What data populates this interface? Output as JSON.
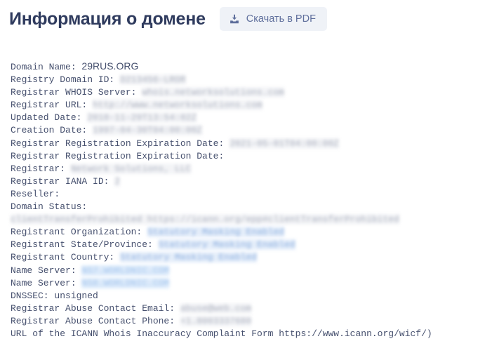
{
  "header": {
    "title": "Информация о домене",
    "pdf_button_label": "Скачать в PDF",
    "pdf_button_icon": "download-icon",
    "title_color": "#2f3b5e",
    "button_bg": "#eff2f7",
    "button_text_color": "#5f6f9c"
  },
  "whois": {
    "lines": [
      {
        "label": "Domain Name: ",
        "value": "29RUS.ORG",
        "style": "plain"
      },
      {
        "label": "Registry Domain ID: ",
        "value": "D213456-LROR",
        "style": "grey"
      },
      {
        "label": "Registrar WHOIS Server: ",
        "value": "whois.networksolutions.com",
        "style": "grey"
      },
      {
        "label": "Registrar URL: ",
        "value": "http://www.networksolutions.com",
        "style": "grey"
      },
      {
        "label": "Updated Date: ",
        "value": "2018-11-29T13:54:02Z",
        "style": "grey"
      },
      {
        "label": "Creation Date: ",
        "value": "1997-04-30T04:00:00Z",
        "style": "grey"
      },
      {
        "label": "Registrar Registration Expiration Date: ",
        "value": "2021-05-01T04:00:00Z",
        "style": "grey"
      },
      {
        "label": "Registrar Registration Expiration Date: ",
        "value": "",
        "style": "none"
      },
      {
        "label": "Registrar: ",
        "value": "Network Solutions, LLC",
        "style": "grey"
      },
      {
        "label": "Registrar IANA ID: ",
        "value": "2",
        "style": "grey"
      },
      {
        "label": "Reseller: ",
        "value": "",
        "style": "none"
      },
      {
        "label": "Domain Status: ",
        "value": "clientTransferProhibited https://icann.org/epp#clientTransferProhibited",
        "style": "grey"
      },
      {
        "label": "Registrant Organization: ",
        "value": "Statutory Masking Enabled",
        "style": "blue"
      },
      {
        "label": "Registrant State/Province: ",
        "value": "Statutory Masking Enabled",
        "style": "blue"
      },
      {
        "label": "Registrant Country: ",
        "value": "Statutory Masking Enabled",
        "style": "blue"
      },
      {
        "label": "Name Server: ",
        "value": "NS7.WORLDNIC.COM",
        "style": "bluestrong"
      },
      {
        "label": "Name Server: ",
        "value": "NS8.WORLDNIC.COM",
        "style": "bluestrong"
      },
      {
        "label": "DNSSEC: ",
        "value": "unsigned",
        "style": "mono"
      },
      {
        "label": "Registrar Abuse Contact Email: ",
        "value": "abuse@web.com",
        "style": "grey"
      },
      {
        "label": "Registrar Abuse Contact Phone: ",
        "value": "+1.8003337680",
        "style": "grey"
      },
      {
        "label": "URL of the ICANN Whois Inaccuracy Complaint Form https://www.icann.org/wicf/)",
        "value": "",
        "style": "none"
      }
    ]
  }
}
